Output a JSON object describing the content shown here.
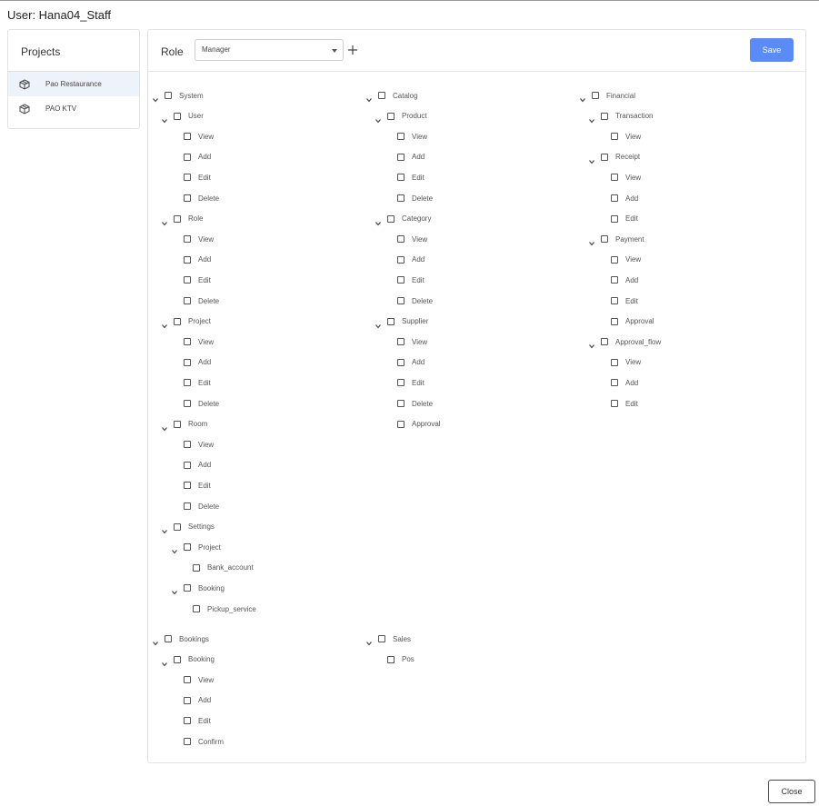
{
  "page": {
    "title": "User: Hana04_Staff"
  },
  "projects": {
    "heading": "Projects",
    "items": [
      {
        "label": "Pao Restaurance",
        "icon": "box-icon",
        "active": true
      },
      {
        "label": "PAO KTV",
        "icon": "box-icon",
        "active": false
      }
    ]
  },
  "role_bar": {
    "label": "Role",
    "selected_role": "Manager",
    "save_label": "Save"
  },
  "permissions": [
    {
      "label": "System",
      "children": [
        {
          "label": "User",
          "children": [
            {
              "label": "View"
            },
            {
              "label": "Add"
            },
            {
              "label": "Edit"
            },
            {
              "label": "Delete"
            }
          ]
        },
        {
          "label": "Role",
          "children": [
            {
              "label": "View"
            },
            {
              "label": "Add"
            },
            {
              "label": "Edit"
            },
            {
              "label": "Delete"
            }
          ]
        },
        {
          "label": "Project",
          "children": [
            {
              "label": "View"
            },
            {
              "label": "Add"
            },
            {
              "label": "Edit"
            },
            {
              "label": "Delete"
            }
          ]
        },
        {
          "label": "Room",
          "children": [
            {
              "label": "View"
            },
            {
              "label": "Add"
            },
            {
              "label": "Edit"
            },
            {
              "label": "Delete"
            }
          ]
        },
        {
          "label": "Settings",
          "children": [
            {
              "label": "Project",
              "children": [
                {
                  "label": "Bank_account"
                }
              ]
            },
            {
              "label": "Booking",
              "children": [
                {
                  "label": "Pickup_service"
                }
              ]
            }
          ]
        }
      ]
    },
    {
      "label": "Catalog",
      "children": [
        {
          "label": "Product",
          "children": [
            {
              "label": "View"
            },
            {
              "label": "Add"
            },
            {
              "label": "Edit"
            },
            {
              "label": "Delete"
            }
          ]
        },
        {
          "label": "Category",
          "children": [
            {
              "label": "View"
            },
            {
              "label": "Add"
            },
            {
              "label": "Edit"
            },
            {
              "label": "Delete"
            }
          ]
        },
        {
          "label": "Supplier",
          "children": [
            {
              "label": "View"
            },
            {
              "label": "Add"
            },
            {
              "label": "Edit"
            },
            {
              "label": "Delete"
            },
            {
              "label": "Approval"
            }
          ]
        }
      ]
    },
    {
      "label": "Financial",
      "children": [
        {
          "label": "Transaction",
          "children": [
            {
              "label": "View"
            }
          ]
        },
        {
          "label": "Receipt",
          "children": [
            {
              "label": "View"
            },
            {
              "label": "Add"
            },
            {
              "label": "Edit"
            }
          ]
        },
        {
          "label": "Payment",
          "children": [
            {
              "label": "View"
            },
            {
              "label": "Add"
            },
            {
              "label": "Edit"
            },
            {
              "label": "Approval"
            }
          ]
        },
        {
          "label": "Approval_flow",
          "children": [
            {
              "label": "View"
            },
            {
              "label": "Add"
            },
            {
              "label": "Edit"
            }
          ]
        }
      ]
    },
    {
      "label": "Bookings",
      "children": [
        {
          "label": "Booking",
          "children": [
            {
              "label": "View"
            },
            {
              "label": "Add"
            },
            {
              "label": "Edit"
            },
            {
              "label": "Confirm"
            }
          ]
        }
      ]
    },
    {
      "label": "Sales",
      "children": [
        {
          "label": "Pos"
        }
      ]
    }
  ],
  "footer": {
    "close_label": "Close"
  }
}
